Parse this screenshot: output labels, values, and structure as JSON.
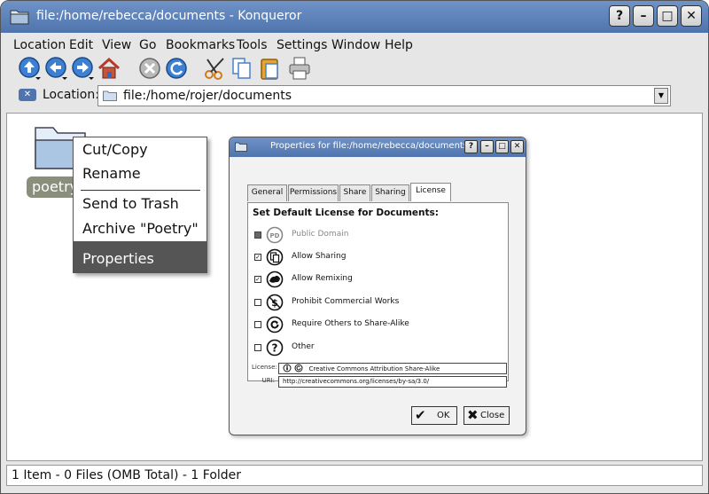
{
  "window": {
    "title": "file:/home/rebecca/documents - Konqueror",
    "help_button": "?",
    "minimize_button": "–",
    "maximize_button": "□",
    "close_button": "✕"
  },
  "menubar": [
    "Location",
    "Edit",
    "View",
    "Go",
    "Bookmarks",
    "Tools",
    "Settings",
    "Window",
    "Help"
  ],
  "location": {
    "label": "Location:",
    "value": "file:/home/rojer/documents"
  },
  "folder": {
    "name": "poetry"
  },
  "context_menu": {
    "items": [
      "Cut/Copy",
      "Rename",
      "Send to Trash",
      "Archive \"Poetry\"",
      "Properties"
    ],
    "selected": "Properties"
  },
  "dialog": {
    "title": "Properties for file:/home/rebecca/documents",
    "help_button": "?",
    "tabs": [
      "General",
      "Permissions",
      "Share",
      "Sharing",
      "License"
    ],
    "active_tab": "License",
    "heading": "Set Default License for Documents:",
    "options": [
      {
        "label": "Public Domain",
        "checked": false,
        "disabled": true,
        "icon": "public-domain-icon",
        "glyph": "PD"
      },
      {
        "label": "Allow Sharing",
        "checked": true,
        "icon": "sharing-icon",
        "glyph": ""
      },
      {
        "label": "Allow Remixing",
        "checked": true,
        "icon": "remix-icon",
        "glyph": ""
      },
      {
        "label": "Prohibit Commercial Works",
        "checked": false,
        "icon": "noncommercial-icon",
        "glyph": "$"
      },
      {
        "label": "Require Others to Share-Alike",
        "checked": false,
        "icon": "share-alike-icon",
        "glyph": ""
      },
      {
        "label": "Other",
        "checked": false,
        "icon": "question-icon",
        "glyph": "?"
      }
    ],
    "license_label": "License:",
    "license_value": "Creative Commons Attribution Share-Alike",
    "uri_label": "URI:",
    "uri_value": "http://creativecommons.org/licenses/by-sa/3.0/",
    "ok_label": "OK",
    "close_label": "Close"
  },
  "status": "1 Item - 0 Files (OMB Total) - 1 Folder",
  "colors": {
    "titlebar": "#5a7fba",
    "selection": "#555555",
    "folder_label_bg": "#8a8f7d"
  }
}
